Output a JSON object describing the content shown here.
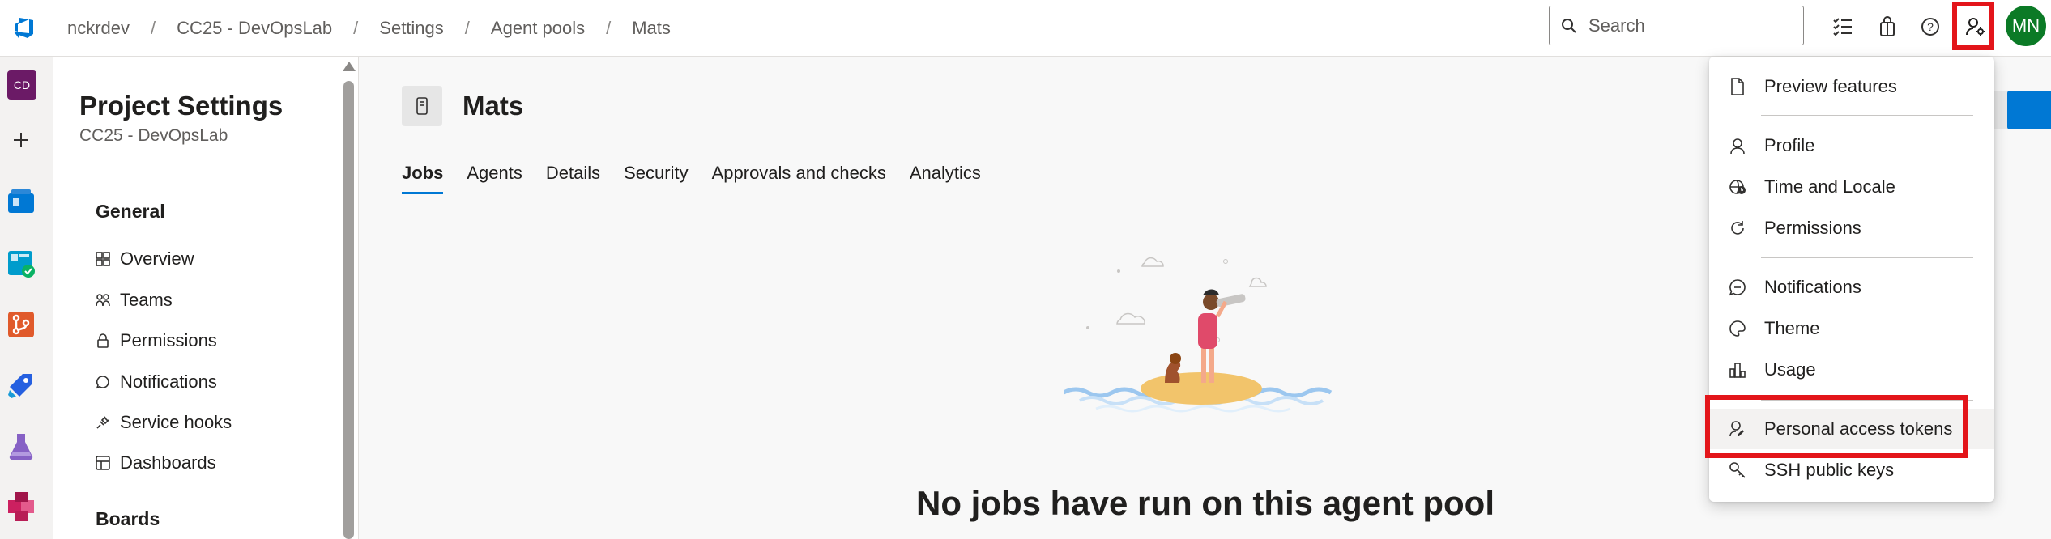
{
  "breadcrumb": {
    "items": [
      "nckrdev",
      "CC25 - DevOpsLab",
      "Settings",
      "Agent pools",
      "Mats"
    ],
    "separator": "/"
  },
  "search": {
    "placeholder": "Search"
  },
  "user": {
    "initials": "MN",
    "avatar_color": "#0b7a26"
  },
  "rail": {
    "project_initials": "CD"
  },
  "settings_nav": {
    "title": "Project Settings",
    "subtitle": "CC25 - DevOpsLab",
    "general_header": "General",
    "items": [
      "Overview",
      "Teams",
      "Permissions",
      "Notifications",
      "Service hooks",
      "Dashboards"
    ],
    "boards_header": "Boards"
  },
  "main": {
    "pool_name": "Mats",
    "tabs": [
      "Jobs",
      "Agents",
      "Details",
      "Security",
      "Approvals and checks",
      "Analytics"
    ],
    "active_tab": "Jobs",
    "empty_title": "No jobs have run on this agent pool"
  },
  "user_menu": {
    "items": [
      "Preview features",
      "Profile",
      "Time and Locale",
      "Permissions",
      "Notifications",
      "Theme",
      "Usage",
      "Personal access tokens",
      "SSH public keys"
    ],
    "highlighted": "Personal access tokens"
  },
  "colors": {
    "accent": "#0078d4",
    "highlight": "#e3151a"
  }
}
